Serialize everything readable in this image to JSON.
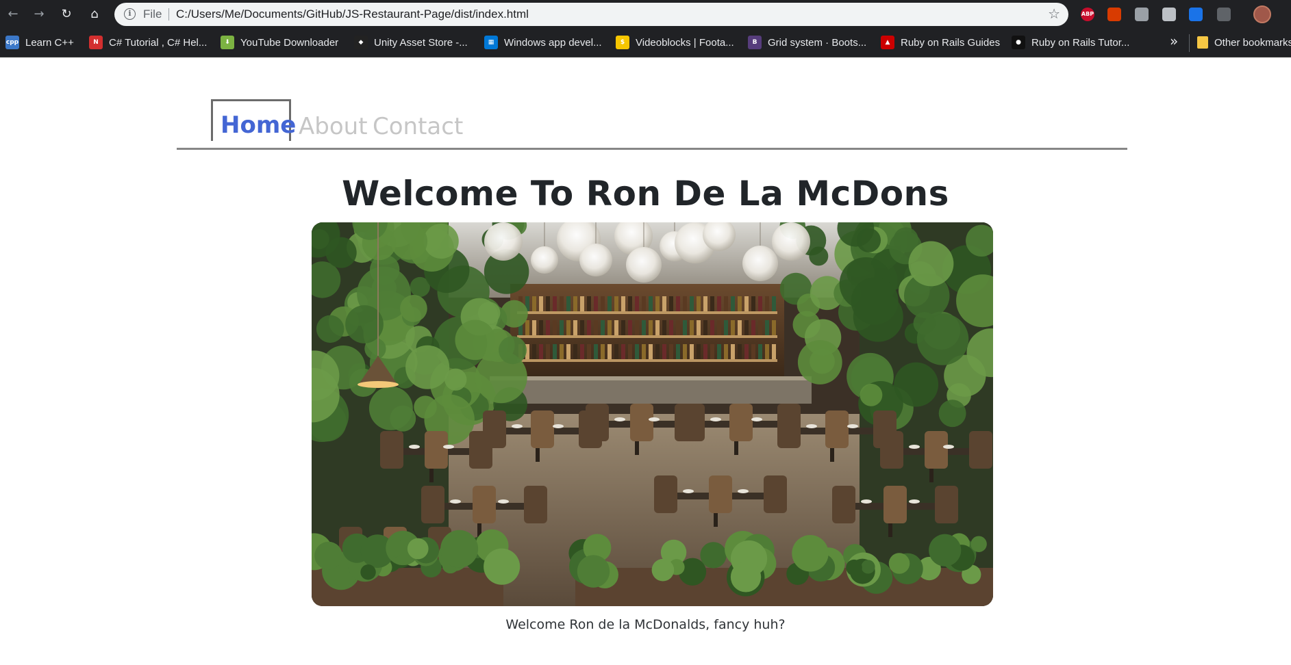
{
  "browser": {
    "nav_back": "←",
    "nav_forward": "→",
    "nav_reload": "↻",
    "nav_home": "⌂",
    "info_glyph": "i",
    "scheme_label": "File",
    "url": "C:/Users/Me/Documents/GitHub/JS-Restaurant-Page/dist/index.html",
    "star_glyph": "☆",
    "extensions": [
      {
        "name": "adblock-plus-icon",
        "label": "ABP",
        "color": "#c70d2c"
      },
      {
        "name": "office-icon",
        "label": "",
        "color": "#d83b01"
      },
      {
        "name": "extension-icon",
        "label": "",
        "color": "#9aa0a6"
      },
      {
        "name": "shield-icon",
        "label": "",
        "color": "#bdc1c6"
      },
      {
        "name": "c-extension-icon",
        "label": "",
        "color": "#1a73e8"
      },
      {
        "name": "puzzle-icon",
        "label": "",
        "color": "#5f6368"
      }
    ]
  },
  "bookmarks": {
    "items": [
      {
        "label": "Learn C++",
        "icon_text": "cpp",
        "icon_color": "#3c78c8",
        "icon_name": "cpp-icon"
      },
      {
        "label": "C# Tutorial , C# Hel...",
        "icon_text": "N",
        "icon_color": "#d32f2f",
        "icon_name": "csharp-tutorial-icon"
      },
      {
        "label": "YouTube Downloader",
        "icon_text": "⬇",
        "icon_color": "#7cb342",
        "icon_name": "download-icon"
      },
      {
        "label": "Unity Asset Store -...",
        "icon_text": "◆",
        "icon_color": "#222222",
        "icon_name": "unity-icon"
      },
      {
        "label": "Windows app devel...",
        "icon_text": "▦",
        "icon_color": "#0078d7",
        "icon_name": "windows-icon"
      },
      {
        "label": "Videoblocks | Foota...",
        "icon_text": "$",
        "icon_color": "#f7c600",
        "icon_name": "videoblocks-icon"
      },
      {
        "label": "Grid system · Boots...",
        "icon_text": "B",
        "icon_color": "#563d7c",
        "icon_name": "bootstrap-icon"
      },
      {
        "label": "Ruby on Rails Guides",
        "icon_text": "▲",
        "icon_color": "#cc0000",
        "icon_name": "rails-icon"
      },
      {
        "label": "Ruby on Rails Tutor...",
        "icon_text": "●",
        "icon_color": "#111111",
        "icon_name": "rails-tutorial-icon"
      }
    ],
    "more": "»",
    "other_label": "Other bookmarks"
  },
  "site": {
    "tabs": {
      "home": "Home",
      "about": "About",
      "contact": "Contact"
    },
    "title": "Welcome To Ron De La McDons",
    "caption": "Welcome Ron de la McDonalds, fancy huh?"
  }
}
